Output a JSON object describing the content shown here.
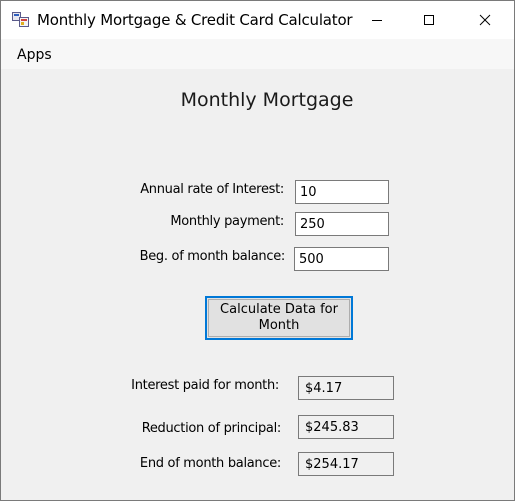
{
  "window": {
    "title": "Monthly Mortgage & Credit Card Calculator",
    "icon": "windows-app-icon"
  },
  "menu": {
    "apps_label": "Apps"
  },
  "form": {
    "heading": "Monthly Mortgage",
    "annual_rate_label": "Annual rate of Interest:",
    "annual_rate_value": "10",
    "monthly_payment_label": "Monthly payment:",
    "monthly_payment_value": "250",
    "beg_balance_label": "Beg. of month balance:",
    "beg_balance_value": "500",
    "calculate_button_label": "Calculate Data for Month",
    "interest_paid_label": "Interest paid for month:",
    "interest_paid_value": "$4.17",
    "reduction_label": "Reduction of principal:",
    "reduction_value": "$245.83",
    "end_balance_label": "End of month balance:",
    "end_balance_value": "$254.17"
  },
  "colors": {
    "accent": "#0078d7",
    "window_bg": "#f0f0f0"
  }
}
